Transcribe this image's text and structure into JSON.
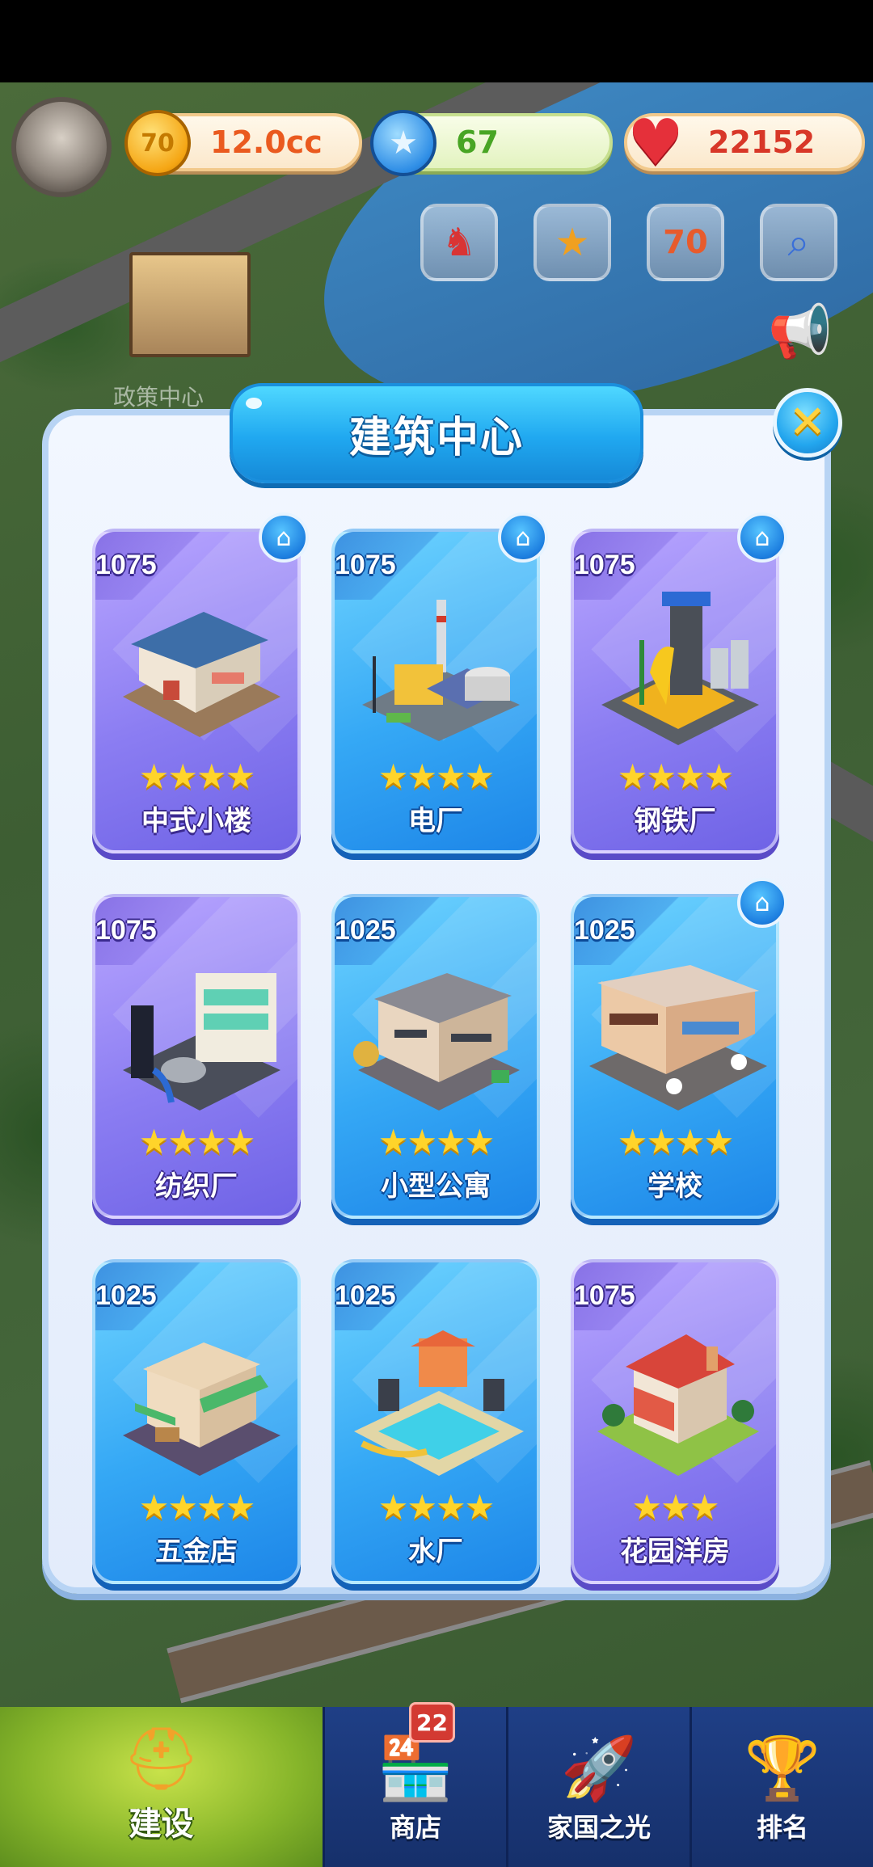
{
  "hud": {
    "coins": "12.0cc",
    "stars": "67",
    "hearts": "22152",
    "coin_symbol": "70",
    "quick_buttons": [
      "hero-icon",
      "handshake-icon",
      "anniversary-70-icon",
      "search-map-icon"
    ],
    "quick_3_text": "70"
  },
  "background": {
    "building_label": "政策中心"
  },
  "dialog": {
    "title": "建筑中心",
    "close_symbol": "✕",
    "buildings": [
      {
        "level": "1075",
        "name": "中式小楼",
        "stars": 4,
        "stars_text": "★★★★",
        "has_home_badge": true,
        "theme": "purple"
      },
      {
        "level": "1075",
        "name": "电厂",
        "stars": 4,
        "stars_text": "★★★★",
        "has_home_badge": true,
        "theme": "blue"
      },
      {
        "level": "1075",
        "name": "钢铁厂",
        "stars": 4,
        "stars_text": "★★★★",
        "has_home_badge": true,
        "theme": "purple"
      },
      {
        "level": "1075",
        "name": "纺织厂",
        "stars": 4,
        "stars_text": "★★★★",
        "has_home_badge": false,
        "theme": "purple"
      },
      {
        "level": "1025",
        "name": "小型公寓",
        "stars": 4,
        "stars_text": "★★★★",
        "has_home_badge": false,
        "theme": "blue"
      },
      {
        "level": "1025",
        "name": "学校",
        "stars": 4,
        "stars_text": "★★★★",
        "has_home_badge": true,
        "theme": "blue"
      },
      {
        "level": "1025",
        "name": "五金店",
        "stars": 4,
        "stars_text": "★★★★",
        "has_home_badge": false,
        "theme": "blue"
      },
      {
        "level": "1025",
        "name": "水厂",
        "stars": 4,
        "stars_text": "★★★★",
        "has_home_badge": false,
        "theme": "blue"
      },
      {
        "level": "1075",
        "name": "花园洋房",
        "stars": 3,
        "stars_text": "★★★",
        "has_home_badge": false,
        "theme": "purple"
      }
    ]
  },
  "nav": {
    "items": [
      {
        "label": "建设",
        "icon": "hardhat-icon",
        "active": true
      },
      {
        "label": "商店",
        "icon": "shop-icon",
        "active": false,
        "badge": "22"
      },
      {
        "label": "家国之光",
        "icon": "rocket-icon",
        "active": false
      },
      {
        "label": "排名",
        "icon": "ranking-icon",
        "active": false
      }
    ]
  },
  "colors": {
    "dialog_bg": "#eaf1fc",
    "card_purple": "#8b7df2",
    "card_blue": "#35a8f5",
    "star": "#ffd42a",
    "nav_bg": "#1f3f86",
    "nav_active": "#86b52a"
  }
}
